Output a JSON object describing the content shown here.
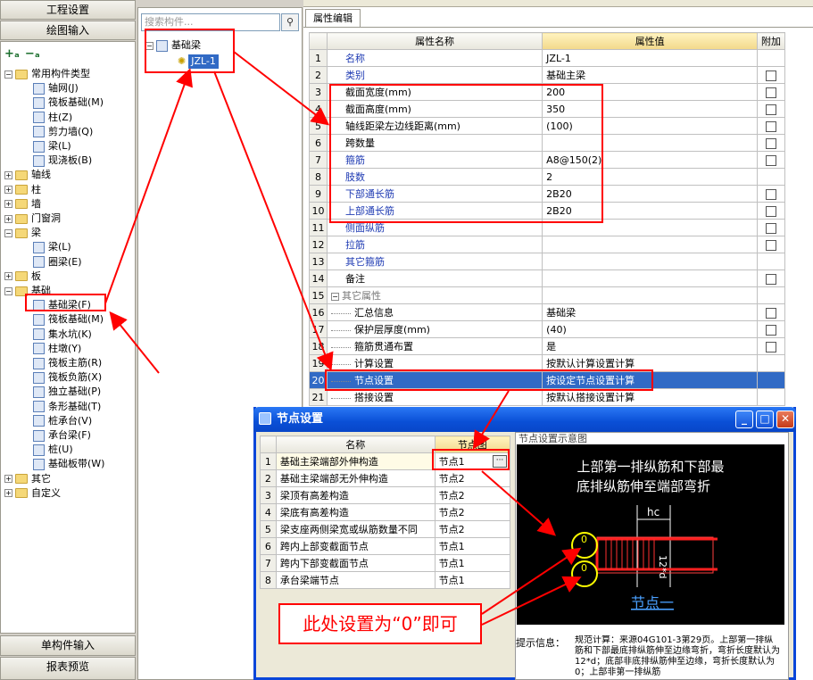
{
  "left_panel": {
    "project_settings": "工程设置",
    "draw_input": "绘图输入",
    "single_input": "单构件输入",
    "report_preview": "报表预览",
    "tree": [
      {
        "label": "常用构件类型",
        "kind": "folder-open"
      },
      {
        "label": "轴网(J)",
        "kind": "item"
      },
      {
        "label": "筏板基础(M)",
        "kind": "item"
      },
      {
        "label": "柱(Z)",
        "kind": "item"
      },
      {
        "label": "剪力墙(Q)",
        "kind": "item"
      },
      {
        "label": "梁(L)",
        "kind": "item"
      },
      {
        "label": "现浇板(B)",
        "kind": "item"
      },
      {
        "label": "轴线",
        "kind": "folder"
      },
      {
        "label": "柱",
        "kind": "folder"
      },
      {
        "label": "墙",
        "kind": "folder"
      },
      {
        "label": "门窗洞",
        "kind": "folder"
      },
      {
        "label": "梁",
        "kind": "folder-open"
      },
      {
        "label": "梁(L)",
        "kind": "item"
      },
      {
        "label": "圈梁(E)",
        "kind": "item"
      },
      {
        "label": "板",
        "kind": "folder"
      },
      {
        "label": "基础",
        "kind": "folder-open"
      },
      {
        "label": "基础梁(F)",
        "kind": "item"
      },
      {
        "label": "筏板基础(M)",
        "kind": "item"
      },
      {
        "label": "集水坑(K)",
        "kind": "item"
      },
      {
        "label": "柱墩(Y)",
        "kind": "item"
      },
      {
        "label": "筏板主筋(R)",
        "kind": "item"
      },
      {
        "label": "筏板负筋(X)",
        "kind": "item"
      },
      {
        "label": "独立基础(P)",
        "kind": "item"
      },
      {
        "label": "条形基础(T)",
        "kind": "item"
      },
      {
        "label": "桩承台(V)",
        "kind": "item"
      },
      {
        "label": "承台梁(F)",
        "kind": "item"
      },
      {
        "label": "桩(U)",
        "kind": "item"
      },
      {
        "label": "基础板带(W)",
        "kind": "item"
      },
      {
        "label": "其它",
        "kind": "folder"
      },
      {
        "label": "自定义",
        "kind": "folder"
      }
    ]
  },
  "middle_panel": {
    "search_placeholder": "搜索构件...",
    "root": "基础梁",
    "child": "JZL-1"
  },
  "property_panel": {
    "tab": "属性编辑",
    "headers": [
      "属性名称",
      "属性值",
      "附加"
    ],
    "rows": [
      {
        "num": "1",
        "name": "名称",
        "value": "JZL-1",
        "style": "blue",
        "cb": false
      },
      {
        "num": "2",
        "name": "类别",
        "value": "基础主梁",
        "style": "blue",
        "cb": true
      },
      {
        "num": "3",
        "name": "截面宽度(mm)",
        "value": "200",
        "style": "",
        "cb": true
      },
      {
        "num": "4",
        "name": "截面高度(mm)",
        "value": "350",
        "style": "",
        "cb": true
      },
      {
        "num": "5",
        "name": "轴线距梁左边线距离(mm)",
        "value": "(100)",
        "style": "",
        "cb": true
      },
      {
        "num": "6",
        "name": "跨数量",
        "value": "",
        "style": "",
        "cb": true
      },
      {
        "num": "7",
        "name": "箍筋",
        "value": "A8@150(2)",
        "style": "blue",
        "cb": true
      },
      {
        "num": "8",
        "name": "肢数",
        "value": "2",
        "style": "blue",
        "cb": false
      },
      {
        "num": "9",
        "name": "下部通长筋",
        "value": "2B20",
        "style": "blue",
        "cb": true
      },
      {
        "num": "10",
        "name": "上部通长筋",
        "value": "2B20",
        "style": "blue",
        "cb": true
      },
      {
        "num": "11",
        "name": "侧面纵筋",
        "value": "",
        "style": "blue",
        "cb": true
      },
      {
        "num": "12",
        "name": "拉筋",
        "value": "",
        "style": "blue",
        "cb": true
      },
      {
        "num": "13",
        "name": "其它箍筋",
        "value": "",
        "style": "blue",
        "cb": false
      },
      {
        "num": "14",
        "name": "备注",
        "value": "",
        "style": "",
        "cb": true
      },
      {
        "num": "15",
        "name": "其它属性",
        "value": "",
        "style": "group",
        "cb": false
      },
      {
        "num": "16",
        "name": "汇总信息",
        "value": "基础梁",
        "style": "sub",
        "cb": true
      },
      {
        "num": "17",
        "name": "保护层厚度(mm)",
        "value": "(40)",
        "style": "sub",
        "cb": true
      },
      {
        "num": "18",
        "name": "箍筋贯通布置",
        "value": "是",
        "style": "sub",
        "cb": true
      },
      {
        "num": "19",
        "name": "计算设置",
        "value": "按默认计算设置计算",
        "style": "sub",
        "cb": false
      },
      {
        "num": "20",
        "name": "节点设置",
        "value": "按设定节点设置计算",
        "style": "sub-sel",
        "cb": false
      },
      {
        "num": "21",
        "name": "搭接设置",
        "value": "按默认搭接设置计算",
        "style": "sub",
        "cb": false
      }
    ]
  },
  "dialog": {
    "title": "节点设置",
    "headers": [
      "名称",
      "节点图"
    ],
    "rows": [
      {
        "num": "1",
        "name": "基础主梁端部外伸构造",
        "value": "节点1"
      },
      {
        "num": "2",
        "name": "基础主梁端部无外伸构造",
        "value": "节点2"
      },
      {
        "num": "3",
        "name": "梁顶有高差构造",
        "value": "节点2"
      },
      {
        "num": "4",
        "name": "梁底有高差构造",
        "value": "节点2"
      },
      {
        "num": "5",
        "name": "梁支座两侧梁宽或纵筋数量不同",
        "value": "节点2"
      },
      {
        "num": "6",
        "name": "跨内上部变截面节点",
        "value": "节点1"
      },
      {
        "num": "7",
        "name": "跨内下部变截面节点",
        "value": "节点1"
      },
      {
        "num": "8",
        "name": "承台梁端节点",
        "value": "节点1"
      }
    ],
    "preview_title": "节点设置示意图",
    "diagram_text_1": "上部第一排纵筋和下部最",
    "diagram_text_2": "底排纵筋伸至端部弯折",
    "diagram_hc": "hc",
    "diagram_dim": "12*d",
    "diagram_zero_1": "0",
    "diagram_zero_2": "0",
    "diagram_node": "节点一",
    "hint_label": "提示信息：",
    "hint_text": "规范计算：来源04G101-3第29页。上部第一排纵筋和下部最底排纵筋伸至边缘弯折，弯折长度默认为12*d；底部非底排纵筋伸至边缘，弯折长度默认为0；上部非第一排纵筋"
  },
  "annotation": {
    "callout": "此处设置为“0”即可"
  },
  "colors": {
    "annotation_red": "#ff0000",
    "selection_blue": "#316ac5",
    "link_blue": "#1f3bb3",
    "xp_title_blue": "#0a4fd6"
  }
}
